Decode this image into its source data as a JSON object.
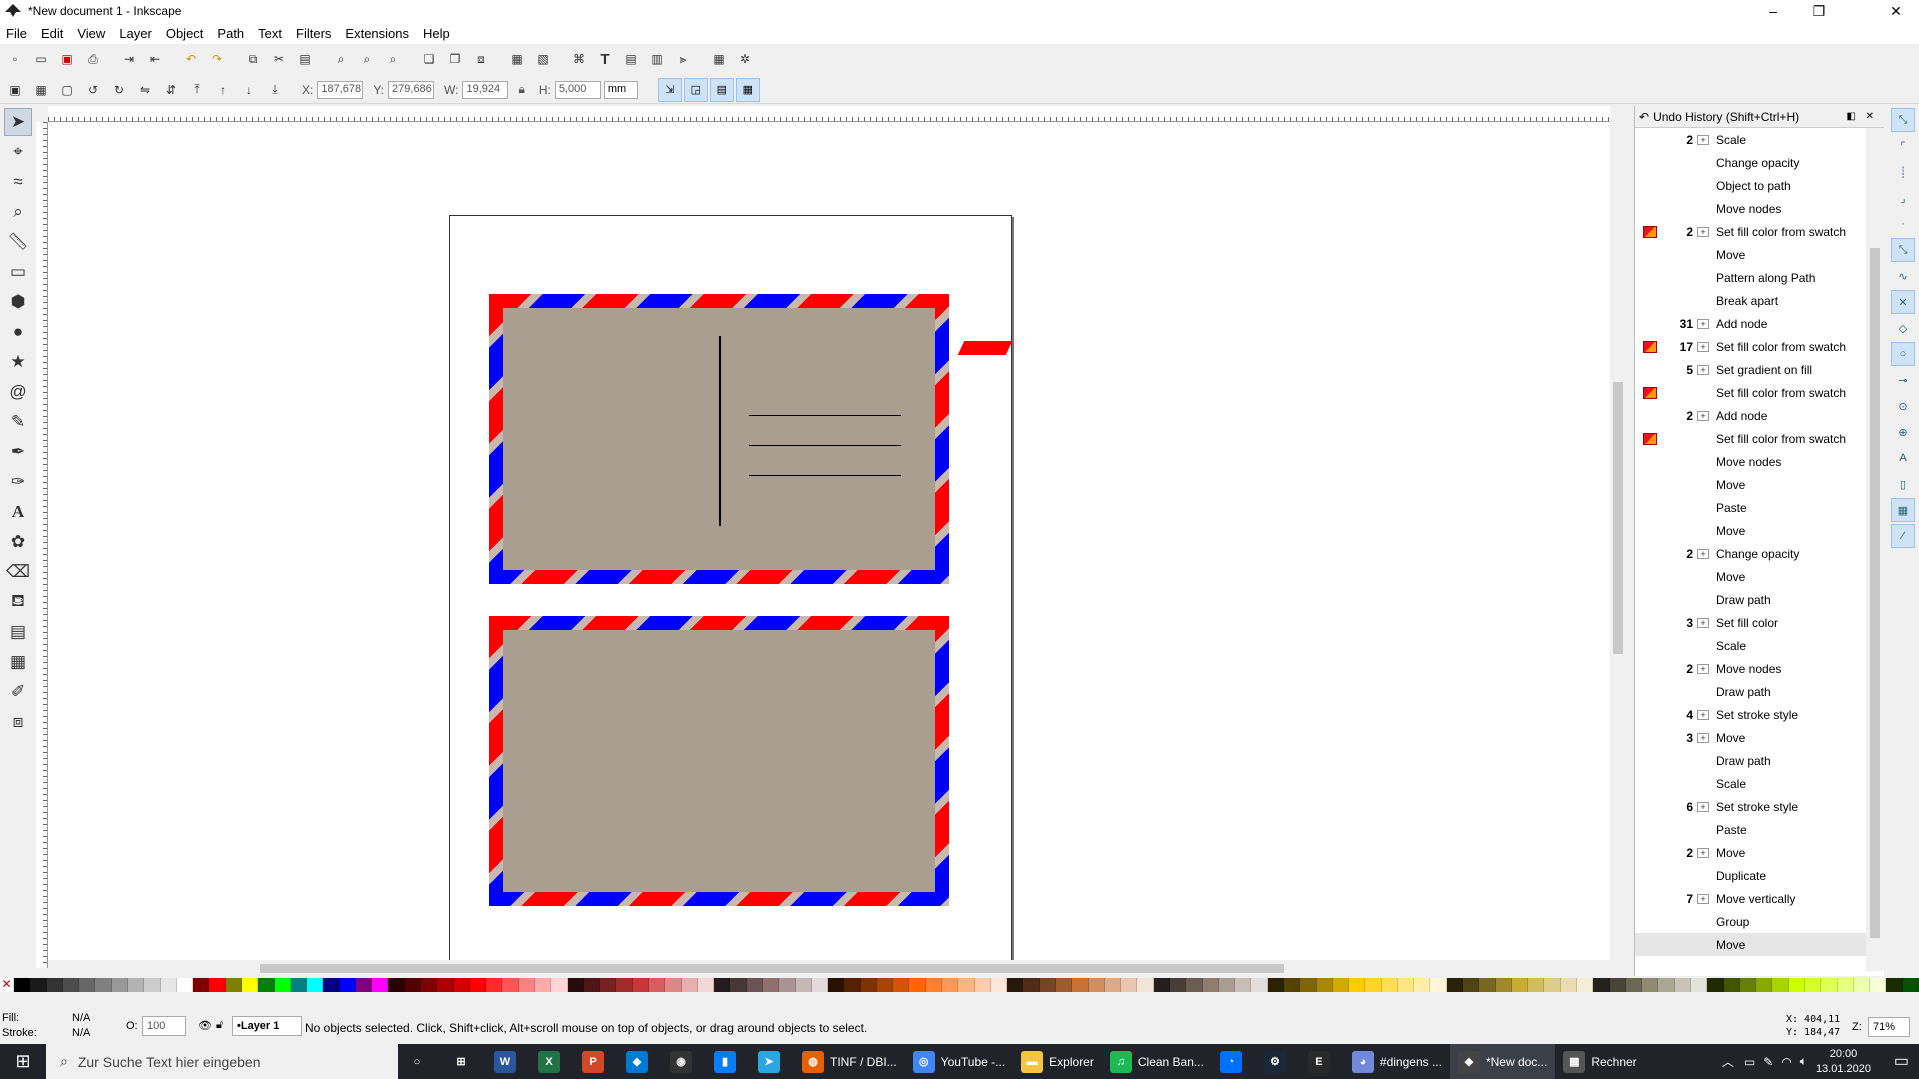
{
  "window": {
    "title": "*New document 1 - Inkscape",
    "controls": [
      "–",
      "❐",
      "✕"
    ]
  },
  "menu": [
    "File",
    "Edit",
    "View",
    "Layer",
    "Object",
    "Path",
    "Text",
    "Filters",
    "Extensions",
    "Help"
  ],
  "toolbar_icons": [
    "new-document-icon",
    "open-icon",
    "save-icon",
    "print-icon",
    "import-icon",
    "export-icon",
    "undo-icon",
    "redo-icon",
    "copy-icon",
    "cut-icon",
    "paste-icon",
    "zoom-selection-icon",
    "zoom-drawing-icon",
    "zoom-page-icon",
    "duplicate-icon",
    "clone-icon",
    "unlink-clone-icon",
    "group-icon",
    "ungroup-icon",
    "xml-editor-icon",
    "text-font-icon",
    "layers-icon",
    "objects-icon",
    "align-icon",
    "document-properties-icon",
    "preferences-icon"
  ],
  "selector_controls": {
    "x_label": "X:",
    "x_value": "187,678",
    "y_label": "Y:",
    "y_value": "279,686",
    "w_label": "W:",
    "w_value": "19,924",
    "h_label": "H:",
    "h_value": "5,000",
    "unit": "mm"
  },
  "tools": [
    "selector-tool",
    "node-tool",
    "tweak-tool",
    "zoom-tool",
    "measure-tool",
    "rectangle-tool",
    "3d-box-tool",
    "ellipse-tool",
    "star-tool",
    "spiral-tool",
    "pencil-tool",
    "pen-tool",
    "calligraphy-tool",
    "text-tool",
    "spray-tool",
    "eraser-tool",
    "paint-bucket-tool",
    "gradient-tool",
    "mesh-tool",
    "dropper-tool",
    "connector-tool"
  ],
  "undo_history": {
    "title": "Undo History (Shift+Ctrl+H)",
    "items": [
      {
        "count": "2",
        "label": "Scale",
        "swatch": false,
        "expand": true
      },
      {
        "count": "",
        "label": "Change opacity",
        "swatch": false,
        "expand": false
      },
      {
        "count": "",
        "label": "Object to path",
        "swatch": false,
        "expand": false
      },
      {
        "count": "",
        "label": "Move nodes",
        "swatch": false,
        "expand": false
      },
      {
        "count": "2",
        "label": "Set fill color from swatch",
        "swatch": true,
        "expand": true
      },
      {
        "count": "",
        "label": "Move",
        "swatch": false,
        "expand": false
      },
      {
        "count": "",
        "label": "Pattern along Path",
        "swatch": false,
        "expand": false
      },
      {
        "count": "",
        "label": "Break apart",
        "swatch": false,
        "expand": false
      },
      {
        "count": "31",
        "label": "Add node",
        "swatch": false,
        "expand": true
      },
      {
        "count": "17",
        "label": "Set fill color from swatch",
        "swatch": true,
        "expand": true
      },
      {
        "count": "5",
        "label": "Set gradient on fill",
        "swatch": false,
        "expand": true
      },
      {
        "count": "",
        "label": "Set fill color from swatch",
        "swatch": true,
        "expand": false
      },
      {
        "count": "2",
        "label": "Add node",
        "swatch": false,
        "expand": true
      },
      {
        "count": "",
        "label": "Set fill color from swatch",
        "swatch": true,
        "expand": false
      },
      {
        "count": "",
        "label": "Move nodes",
        "swatch": false,
        "expand": false
      },
      {
        "count": "",
        "label": "Move",
        "swatch": false,
        "expand": false
      },
      {
        "count": "",
        "label": "Paste",
        "swatch": false,
        "expand": false
      },
      {
        "count": "",
        "label": "Move",
        "swatch": false,
        "expand": false
      },
      {
        "count": "2",
        "label": "Change opacity",
        "swatch": false,
        "expand": true
      },
      {
        "count": "",
        "label": "Move",
        "swatch": false,
        "expand": false
      },
      {
        "count": "",
        "label": "Draw path",
        "swatch": false,
        "expand": false
      },
      {
        "count": "3",
        "label": "Set fill color",
        "swatch": false,
        "expand": true
      },
      {
        "count": "",
        "label": "Scale",
        "swatch": false,
        "expand": false
      },
      {
        "count": "2",
        "label": "Move nodes",
        "swatch": false,
        "expand": true
      },
      {
        "count": "",
        "label": "Draw path",
        "swatch": false,
        "expand": false
      },
      {
        "count": "4",
        "label": "Set stroke style",
        "swatch": false,
        "expand": true
      },
      {
        "count": "3",
        "label": "Move",
        "swatch": false,
        "expand": true
      },
      {
        "count": "",
        "label": "Draw path",
        "swatch": false,
        "expand": false
      },
      {
        "count": "",
        "label": "Scale",
        "swatch": false,
        "expand": false
      },
      {
        "count": "6",
        "label": "Set stroke style",
        "swatch": false,
        "expand": true
      },
      {
        "count": "",
        "label": "Paste",
        "swatch": false,
        "expand": false
      },
      {
        "count": "2",
        "label": "Move",
        "swatch": false,
        "expand": true
      },
      {
        "count": "",
        "label": "Duplicate",
        "swatch": false,
        "expand": false
      },
      {
        "count": "7",
        "label": "Move vertically",
        "swatch": false,
        "expand": true
      },
      {
        "count": "",
        "label": "Group",
        "swatch": false,
        "expand": false
      },
      {
        "count": "",
        "label": "Move",
        "swatch": false,
        "expand": false
      }
    ]
  },
  "snap_icons": [
    "snap-toggle-icon",
    "snap-bbox-icon",
    "snap-bbox-edge-icon",
    "snap-bbox-corner-icon",
    "snap-bbox-midpoint-icon",
    "snap-nodes-icon",
    "snap-path-icon",
    "snap-intersection-icon",
    "snap-cusp-node-icon",
    "snap-smooth-node-icon",
    "snap-line-midpoint-icon",
    "snap-object-center-icon",
    "snap-rotation-center-icon",
    "snap-text-baseline-icon",
    "snap-page-border-icon",
    "snap-grid-icon",
    "snap-guide-icon"
  ],
  "status": {
    "fill_label": "Fill:",
    "fill_value": "N/A",
    "stroke_label": "Stroke:",
    "stroke_value": "N/A",
    "opacity_label": "O:",
    "opacity_value": "100",
    "layer": "•Layer 1",
    "message": "No objects selected. Click, Shift+click, Alt+scroll mouse on top of objects, or drag around objects to select.",
    "coord_x": "X: 404,11",
    "coord_y": "Y: 184,47",
    "zoom_label": "Z:",
    "zoom": "71%"
  },
  "taskbar": {
    "search_placeholder": "Zur Suche Text hier eingeben",
    "apps": [
      {
        "name": "task-view",
        "label": "",
        "icon": "○",
        "color": "transparent"
      },
      {
        "name": "task-switch",
        "label": "",
        "icon": "⊞",
        "color": "transparent"
      },
      {
        "name": "word",
        "label": "",
        "icon": "W",
        "color": "#2b579a"
      },
      {
        "name": "excel",
        "label": "",
        "icon": "X",
        "color": "#217346"
      },
      {
        "name": "powerpoint",
        "label": "",
        "icon": "P",
        "color": "#d24726"
      },
      {
        "name": "vscode",
        "label": "",
        "icon": "◆",
        "color": "#0078d4"
      },
      {
        "name": "obs",
        "label": "",
        "icon": "◉",
        "color": "#333"
      },
      {
        "name": "jetbrains",
        "label": "",
        "icon": "▮",
        "color": "#087cfa"
      },
      {
        "name": "telegram",
        "label": "",
        "icon": "➤",
        "color": "#2ca5e0"
      },
      {
        "name": "firefox",
        "label": "TINF / DBI...",
        "icon": "◍",
        "color": "#e66000"
      },
      {
        "name": "chrome",
        "label": "YouTube -...",
        "icon": "◎",
        "color": "#4285f4"
      },
      {
        "name": "explorer",
        "label": "Explorer",
        "icon": "▬",
        "color": "#f4c542"
      },
      {
        "name": "spotify",
        "label": "Clean Ban...",
        "icon": "♫",
        "color": "#1db954"
      },
      {
        "name": "uplay",
        "label": "",
        "icon": "◔",
        "color": "#0070ff"
      },
      {
        "name": "steam",
        "label": "",
        "icon": "⚙",
        "color": "#1b2838"
      },
      {
        "name": "epic",
        "label": "",
        "icon": "E",
        "color": "#2a2a2a"
      },
      {
        "name": "discord",
        "label": "#dingens ...",
        "icon": "◕",
        "color": "#7289da"
      },
      {
        "name": "inkscape",
        "label": "*New doc...",
        "icon": "◆",
        "color": "#444"
      },
      {
        "name": "calculator",
        "label": "Rechner",
        "icon": "▦",
        "color": "#555"
      }
    ],
    "time": "20:00",
    "date": "13.01.2020"
  },
  "palette_colors": [
    "#000000",
    "#1a1a1a",
    "#333333",
    "#4d4d4d",
    "#666666",
    "#808080",
    "#999999",
    "#b3b3b3",
    "#cccccc",
    "#e6e6e6",
    "#ffffff",
    "#800000",
    "#ff0000",
    "#808000",
    "#ffff00",
    "#008000",
    "#00ff00",
    "#008080",
    "#00ffff",
    "#000080",
    "#0000ff",
    "#800080",
    "#ff00ff",
    "#2b0000",
    "#550000",
    "#800000",
    "#aa0000",
    "#d40000",
    "#ff0000",
    "#ff2a2a",
    "#ff5555",
    "#ff8080",
    "#ffaaaa",
    "#ffd5d5",
    "#280b0b",
    "#501616",
    "#782121",
    "#a02c2c",
    "#c83737",
    "#d35f5f",
    "#de8787",
    "#e9afaf",
    "#f4d7d7",
    "#241c1c",
    "#483737",
    "#6c5353",
    "#916f6f",
    "#ac9393",
    "#c8b7b7",
    "#e3dbdb",
    "#2b1100",
    "#552200",
    "#803300",
    "#aa4400",
    "#d45500",
    "#ff6600",
    "#ff7f2a",
    "#ff9955",
    "#ffb380",
    "#ffccaa",
    "#ffe6d5",
    "#28170b",
    "#502d16",
    "#784421",
    "#a05a2c",
    "#c87137",
    "#d38d5f",
    "#deaa87",
    "#e9c6af",
    "#f4e3d7",
    "#241f1c",
    "#483e37",
    "#6c5d53",
    "#917c6f",
    "#ac9d93",
    "#c8beb7",
    "#e3dedb",
    "#2b2200",
    "#554400",
    "#806600",
    "#aa8800",
    "#d4aa00",
    "#ffcc00",
    "#ffd42a",
    "#ffdd55",
    "#ffe680",
    "#ffeeaa",
    "#fff6d5",
    "#28220b",
    "#504416",
    "#786721",
    "#a0892c",
    "#c8ab37",
    "#d3bc5f",
    "#decd87",
    "#e9ddaf",
    "#f4eed7",
    "#24221c",
    "#484537",
    "#6c6753",
    "#918a6f",
    "#aca793",
    "#c8c4b7",
    "#e3e2db",
    "#222b00",
    "#445500",
    "#668000",
    "#88aa00",
    "#aad400",
    "#ccff00",
    "#d4ff2a",
    "#ddff55",
    "#e5ff80",
    "#eeffaa",
    "#f6ffd5",
    "#1a2b00",
    "#005500"
  ]
}
